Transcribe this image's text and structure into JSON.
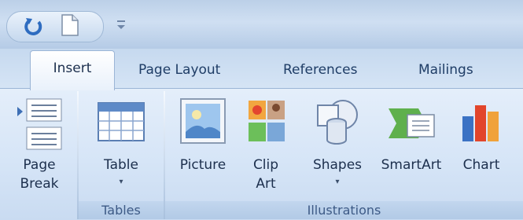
{
  "tabs": {
    "active": "Insert",
    "page_layout": "Page Layout",
    "references": "References",
    "mailings": "Mailings"
  },
  "ribbon": {
    "page_break": {
      "line1": "Page",
      "line2": "Break"
    },
    "table": {
      "label": "Table",
      "dropdown": "▾"
    },
    "picture": {
      "label": "Picture"
    },
    "clip_art": {
      "line1": "Clip",
      "line2": "Art"
    },
    "shapes": {
      "label": "Shapes",
      "dropdown": "▾"
    },
    "smartart": {
      "label": "SmartArt"
    },
    "chart": {
      "label": "Chart"
    }
  },
  "groups": {
    "tables": "Tables",
    "illustrations": "Illustrations"
  },
  "colors": {
    "ribbon_bg": "#d6e5f7",
    "tab_text": "#1f3d66",
    "group_label": "#3d5a86"
  }
}
